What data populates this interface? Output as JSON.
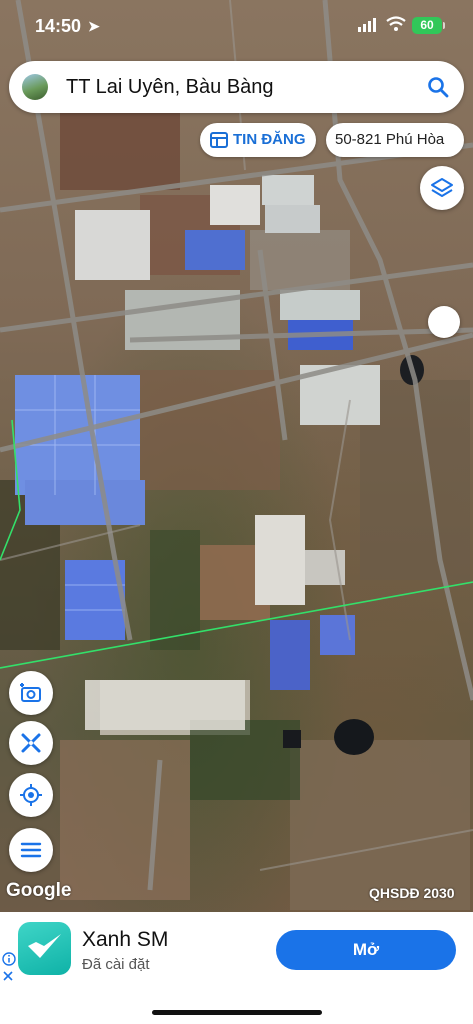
{
  "status_bar": {
    "time": "14:50",
    "battery": "60",
    "icons": [
      "location-arrow-icon",
      "signal-icon",
      "wifi-icon",
      "battery-icon"
    ]
  },
  "search": {
    "query": "TT Lai Uyên, Bàu Bàng",
    "icon": "search-icon"
  },
  "chips": {
    "listing_label": "TIN ĐĂNG",
    "listing_icon": "listing-icon",
    "parcel_label": "50-821 Phú Hòa"
  },
  "map": {
    "attribution": "Google",
    "overlay_label": "QHSDĐ 2030",
    "tools": [
      "add-photo-icon",
      "measure-icon",
      "my-location-icon",
      "menu-icon"
    ],
    "layers_icon": "layers-icon"
  },
  "ad": {
    "app_name": "Xanh SM",
    "app_status": "Đã cài đặt",
    "open_label": "Mở",
    "accent_color": "#1a73e8",
    "icon_color": "#1fbfb3"
  }
}
